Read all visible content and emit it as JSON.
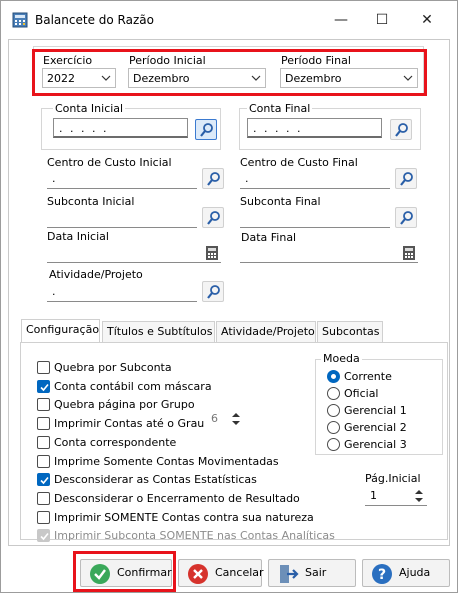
{
  "window": {
    "title": "Balancete do Razão",
    "minimize_glyph": "—",
    "maximize_glyph": "☐",
    "close_glyph": "✕"
  },
  "periodo": {
    "exercicio_label": "Exercício",
    "exercicio_value": "2022",
    "inicial_label": "Período Inicial",
    "inicial_value": "Dezembro",
    "final_label": "Período Final",
    "final_value": "Dezembro"
  },
  "contas": {
    "inicial_label": "Conta Inicial",
    "inicial_value": ". . . . .",
    "final_label": "Conta Final",
    "final_value": ". . . . ."
  },
  "centro_custo": {
    "inicial_label": "Centro de Custo Inicial",
    "inicial_value": ".",
    "final_label": "Centro de Custo Final",
    "final_value": "."
  },
  "subconta": {
    "inicial_label": "Subconta Inicial",
    "inicial_value": "",
    "final_label": "Subconta Final",
    "final_value": ""
  },
  "data": {
    "inicial_label": "Data Inicial",
    "inicial_value": "",
    "final_label": "Data Final",
    "final_value": ""
  },
  "atividade": {
    "label": "Atividade/Projeto",
    "value": "."
  },
  "tabs": [
    {
      "label": "Configuração",
      "active": true
    },
    {
      "label": "Títulos e Subtítulos",
      "active": false
    },
    {
      "label": "Atividade/Projeto",
      "active": false
    },
    {
      "label": "Subcontas",
      "active": false
    }
  ],
  "options": [
    {
      "label": "Quebra por Subconta",
      "checked": false,
      "disabled": false
    },
    {
      "label": "Conta contábil com máscara",
      "checked": true,
      "disabled": false
    },
    {
      "label": "Quebra página por Grupo",
      "checked": false,
      "disabled": false
    },
    {
      "label": "Imprimir Contas até o Grau",
      "checked": false,
      "disabled": false
    },
    {
      "label": "Conta correspondente",
      "checked": false,
      "disabled": false
    },
    {
      "label": "Imprime Somente Contas Movimentadas",
      "checked": false,
      "disabled": false
    },
    {
      "label": "Desconsiderar as Contas Estatísticas",
      "checked": true,
      "disabled": false
    },
    {
      "label": "Desconsiderar o Encerramento de Resultado",
      "checked": false,
      "disabled": false
    },
    {
      "label": "Imprimir SOMENTE Contas contra sua natureza",
      "checked": false,
      "disabled": false
    },
    {
      "label": "Imprimir Subconta SOMENTE nas Contas Analíticas",
      "checked": true,
      "disabled": true
    }
  ],
  "grau_value": "6",
  "moeda": {
    "label": "Moeda",
    "options": [
      {
        "label": "Corrente",
        "selected": true
      },
      {
        "label": "Oficial",
        "selected": false
      },
      {
        "label": "Gerencial 1",
        "selected": false
      },
      {
        "label": "Gerencial 2",
        "selected": false
      },
      {
        "label": "Gerencial 3",
        "selected": false
      }
    ]
  },
  "pag_inicial": {
    "label": "Pág.Inicial",
    "value": "1"
  },
  "buttons": {
    "confirmar": "Confirmar",
    "cancelar": "Cancelar",
    "sair": "Sair",
    "ajuda": "Ajuda"
  },
  "colors": {
    "accent": "#0067c0",
    "highlight_frame": "#e8131b"
  }
}
